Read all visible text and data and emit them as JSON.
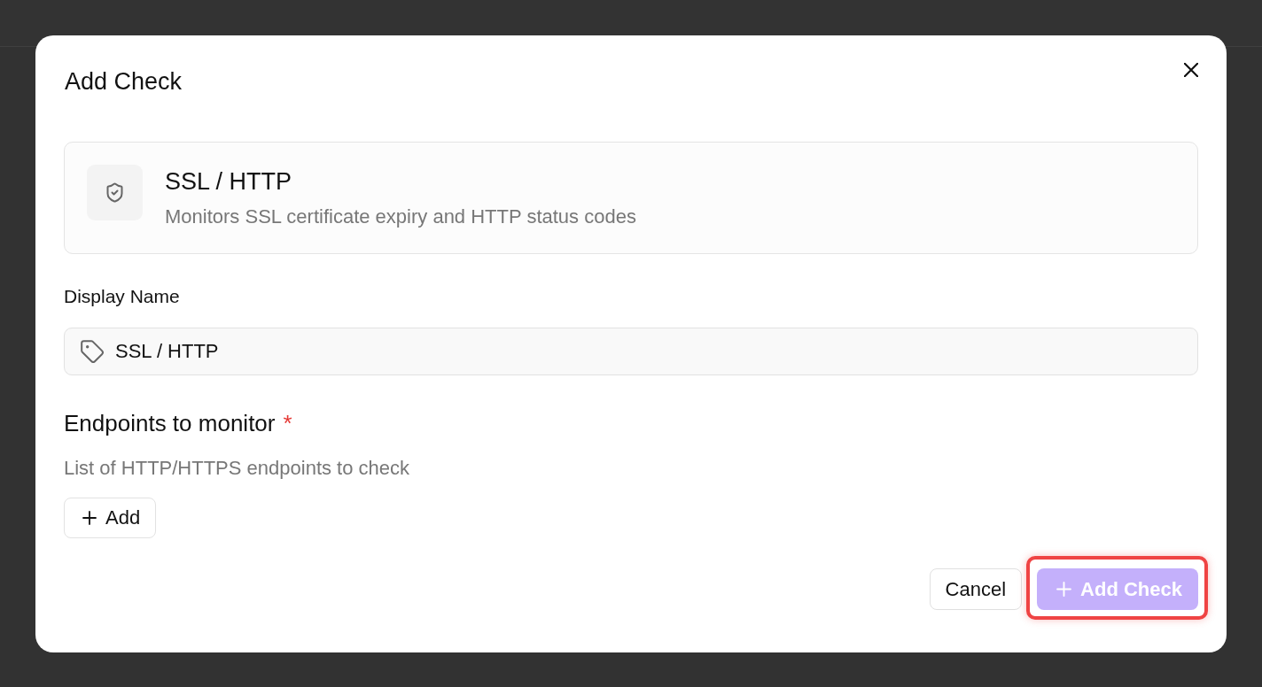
{
  "dialog": {
    "title": "Add Check",
    "check_type": {
      "name": "SSL / HTTP",
      "description": "Monitors SSL certificate expiry and HTTP status codes"
    },
    "display_name": {
      "label": "Display Name",
      "value": "SSL / HTTP"
    },
    "endpoints": {
      "label": "Endpoints to monitor",
      "required_mark": "*",
      "hint": "List of HTTP/HTTPS endpoints to check",
      "add_button": "Add"
    },
    "buttons": [
      {
        "label": "Cancel",
        "kind": "secondary",
        "disabled": false,
        "highlighted": false
      },
      {
        "label": "Add Check",
        "kind": "primary",
        "disabled": true,
        "highlighted": true
      }
    ]
  }
}
